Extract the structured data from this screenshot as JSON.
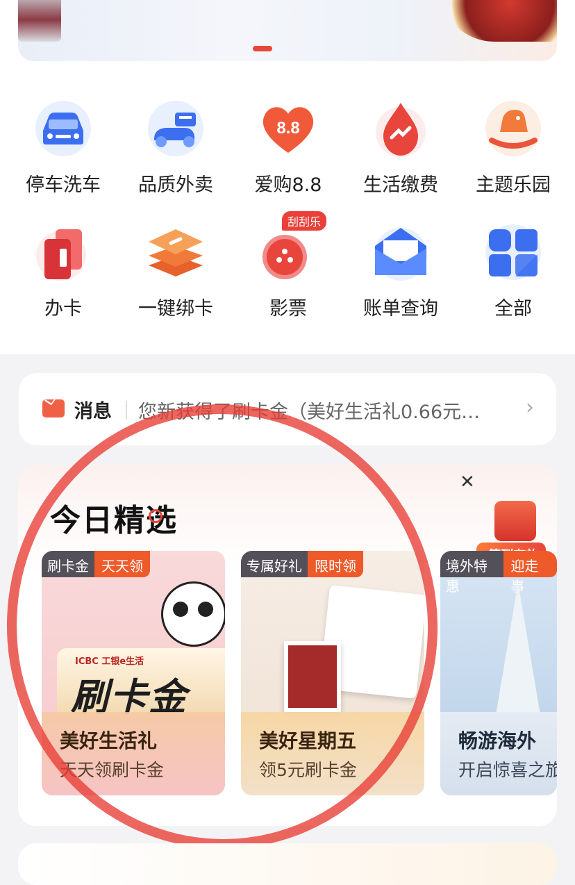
{
  "services": [
    {
      "label": "停车洗车",
      "icon": "car-icon"
    },
    {
      "label": "品质外卖",
      "icon": "scooter-icon"
    },
    {
      "label": "爱购8.8",
      "icon": "heart-88-icon",
      "icon_text": "8.8"
    },
    {
      "label": "生活缴费",
      "icon": "drop-icon"
    },
    {
      "label": "主题乐园",
      "icon": "rocking-horse-icon"
    },
    {
      "label": "办卡",
      "icon": "card-icon"
    },
    {
      "label": "一键绑卡",
      "icon": "link-stack-icon"
    },
    {
      "label": "影票",
      "icon": "film-reel-icon",
      "badge": "刮刮乐"
    },
    {
      "label": "账单查询",
      "icon": "envelope-icon"
    },
    {
      "label": "全部",
      "icon": "all-grid-icon"
    }
  ],
  "message": {
    "title": "消息",
    "text": "您新获得了刷卡金（美好生活礼0.66元…"
  },
  "selection": {
    "title": "今日精选",
    "checkin_label": "签到有礼",
    "cards": [
      {
        "tag1": "刷卡金",
        "tag2": "天天领",
        "art_brand": "ICBC 工银e生活",
        "art_text": "刷卡金",
        "heading": "美好生活礼",
        "sub": "天天领刷卡金"
      },
      {
        "tag1": "专属好礼",
        "tag2": "限时领",
        "heading": "美好星期五",
        "sub": "领5元刷卡金"
      },
      {
        "tag1": "境外特惠",
        "tag2": "迎走事",
        "heading": "畅游海外",
        "sub": "开启惊喜之旅"
      }
    ]
  },
  "colors": {
    "accent": "#e8453c",
    "tag_dark": "#54505a",
    "tag_orange": "#ef5a2a"
  }
}
